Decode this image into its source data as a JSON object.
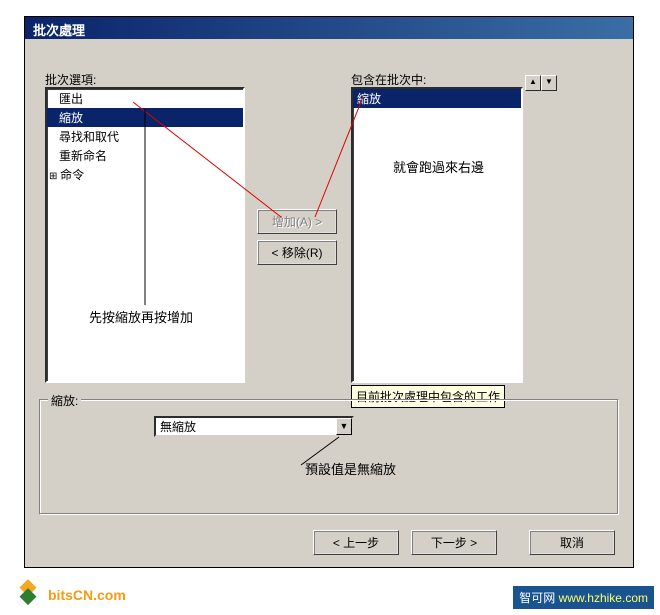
{
  "dialog": {
    "title": "批次處理"
  },
  "leftPanel": {
    "label": "批次選項:",
    "items": [
      {
        "text": "匯出",
        "selected": false
      },
      {
        "text": "縮放",
        "selected": true
      },
      {
        "text": "尋找和取代",
        "selected": false
      },
      {
        "text": "重新命名",
        "selected": false
      }
    ],
    "rootItem": "命令"
  },
  "rightPanel": {
    "label": "包含在批次中:",
    "items": [
      {
        "text": "縮放",
        "selected": true
      }
    ],
    "tooltip": "目前批次處理中包含的工作"
  },
  "buttons": {
    "add": "增加(A) >",
    "remove": "< 移除(R)",
    "back": "< 上一步",
    "next": "下一步 >",
    "cancel": "取消"
  },
  "fieldset": {
    "label": "縮放:",
    "comboValue": "無縮放"
  },
  "annotations": {
    "rightNote": "就會跑過來右邊",
    "leftNote": "先按縮放再按增加",
    "bottomNote": "預設值是無縮放"
  },
  "branding": {
    "logoText": "bitsCN.com",
    "watermark1": "智可网",
    "watermark2": "www.hzhike.com"
  }
}
